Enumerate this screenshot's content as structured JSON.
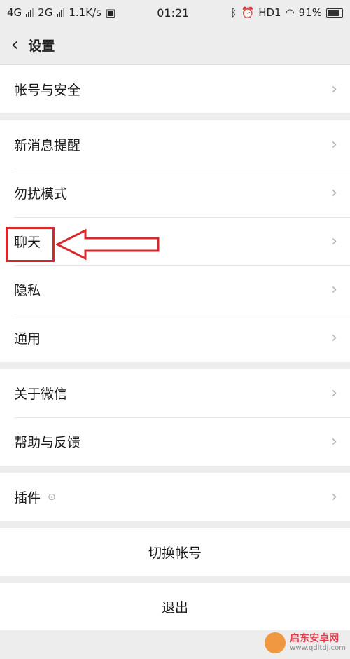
{
  "status_bar": {
    "net1": "4G",
    "net2": "2G",
    "speed": "1.1K/s",
    "time": "01:21",
    "right": "HD1",
    "battery": "91%"
  },
  "header": {
    "title": "设置"
  },
  "groups": {
    "account": "帐号与安全",
    "notify": "新消息提醒",
    "dnd": "勿扰模式",
    "chat": "聊天",
    "privacy": "隐私",
    "general": "通用",
    "about": "关于微信",
    "help": "帮助与反馈",
    "plugins": "插件"
  },
  "buttons": {
    "switch_account": "切换帐号",
    "logout": "退出"
  },
  "watermark": {
    "name": "启东安卓网",
    "url": "www.qdltdj.com"
  },
  "colors": {
    "highlight": "#d8282b"
  }
}
